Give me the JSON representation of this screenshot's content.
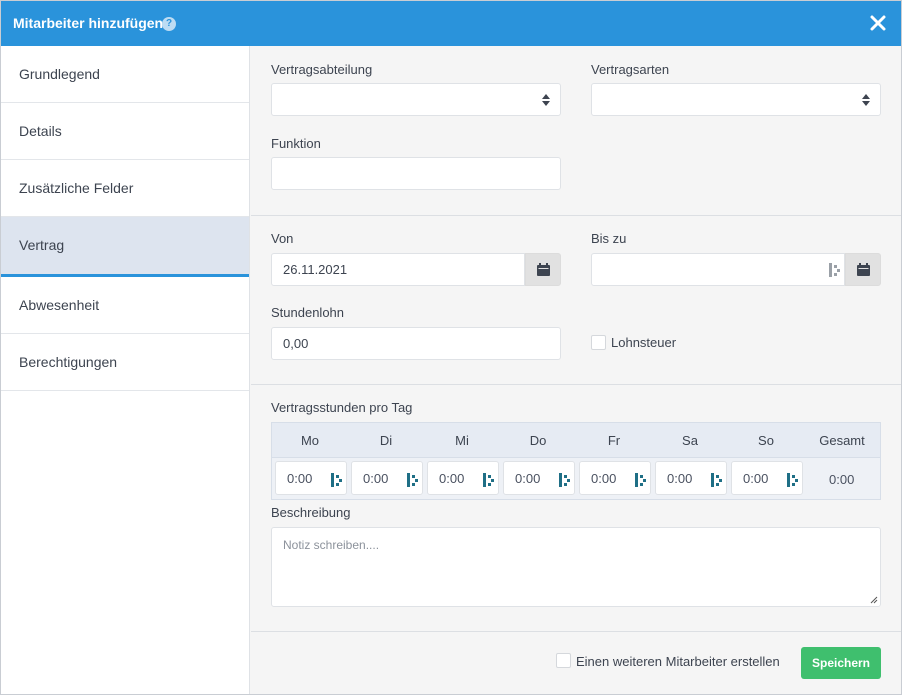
{
  "header": {
    "title": "Mitarbeiter hinzufügen",
    "help_glyph": "?"
  },
  "sidebar": {
    "items": [
      {
        "label": "Grundlegend",
        "active": false
      },
      {
        "label": "Details",
        "active": false
      },
      {
        "label": "Zusätzliche Felder",
        "active": false
      },
      {
        "label": "Vertrag",
        "active": true
      },
      {
        "label": "Abwesenheit",
        "active": false
      },
      {
        "label": "Berechtigungen",
        "active": false
      }
    ]
  },
  "form": {
    "vertragsabteilung": {
      "label": "Vertragsabteilung",
      "value": ""
    },
    "vertragsarten": {
      "label": "Vertragsarten",
      "value": ""
    },
    "funktion": {
      "label": "Funktion",
      "value": ""
    },
    "von": {
      "label": "Von",
      "value": "26.11.2021"
    },
    "bis_zu": {
      "label": "Bis zu",
      "value": ""
    },
    "stundenlohn": {
      "label": "Stundenlohn",
      "value": "0,00"
    },
    "lohnsteuer": {
      "label": "Lohnsteuer",
      "checked": false
    },
    "vertragsstunden": {
      "label": "Vertragsstunden pro Tag",
      "days": [
        {
          "day": "Mo",
          "value": "0:00"
        },
        {
          "day": "Di",
          "value": "0:00"
        },
        {
          "day": "Mi",
          "value": "0:00"
        },
        {
          "day": "Do",
          "value": "0:00"
        },
        {
          "day": "Fr",
          "value": "0:00"
        },
        {
          "day": "Sa",
          "value": "0:00"
        },
        {
          "day": "So",
          "value": "0:00"
        }
      ],
      "total_label": "Gesamt",
      "total_value": "0:00"
    },
    "beschreibung": {
      "label": "Beschreibung",
      "placeholder": "Notiz schreiben...."
    }
  },
  "footer": {
    "another_label": "Einen weiteren Mitarbeiter erstellen",
    "another_checked": false,
    "save_label": "Speichern"
  },
  "colors": {
    "header": "#2a93db",
    "active_tab": "#dde4ef",
    "save": "#3fbf6e",
    "time_icon": "#1f6f86"
  }
}
